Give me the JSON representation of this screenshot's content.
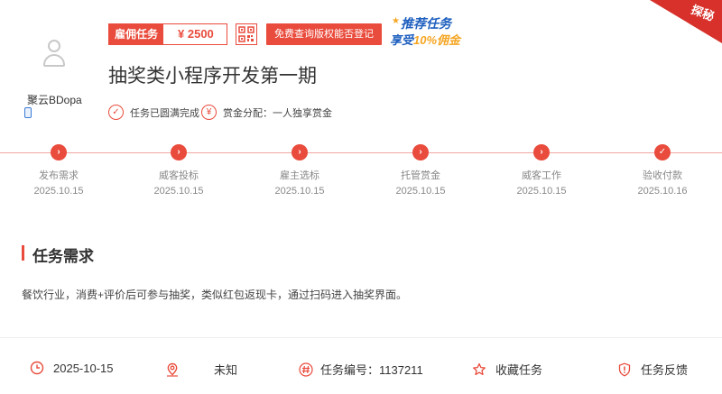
{
  "corner": {
    "label": "探秘"
  },
  "user": {
    "name": "聚云BDopa"
  },
  "reward": {
    "label": "雇佣任务",
    "amount": "¥  2500"
  },
  "check_button": "免费查询版权能否登记",
  "promo": {
    "line1": "推荐任务",
    "line2_a": "享受",
    "line2_b": "10%佣金"
  },
  "title": "抽奖类小程序开发第一期",
  "meta": [
    {
      "icon": "check-circle-icon",
      "text": "任务已圆满完成"
    },
    {
      "icon": "yen-circle-icon",
      "text": "赏金分配：一人独享赏金"
    }
  ],
  "steps": [
    {
      "name": "发布需求",
      "date": "2025.10.15",
      "icon": "chevron-right-icon"
    },
    {
      "name": "威客投标",
      "date": "2025.10.15",
      "icon": "chevron-right-icon"
    },
    {
      "name": "雇主选标",
      "date": "2025.10.15",
      "icon": "chevron-right-icon"
    },
    {
      "name": "托管赏金",
      "date": "2025.10.15",
      "icon": "chevron-right-icon"
    },
    {
      "name": "威客工作",
      "date": "2025.10.15",
      "icon": "chevron-right-icon"
    },
    {
      "name": "验收付款",
      "date": "2025.10.16",
      "icon": "check-icon"
    }
  ],
  "section": {
    "title": "任务需求"
  },
  "description": "餐饮行业，消费+评价后可参与抽奖，类似红包返现卡，通过扫码进入抽奖界面。",
  "footer": {
    "date": "2025-10-15",
    "location": "未知",
    "task_no": "任务编号：1137211",
    "favorite": "收藏任务",
    "feedback": "任务反馈"
  },
  "colors": {
    "accent": "#e94b3c",
    "promo_blue": "#1e5fbf",
    "promo_gold": "#f5a623"
  }
}
